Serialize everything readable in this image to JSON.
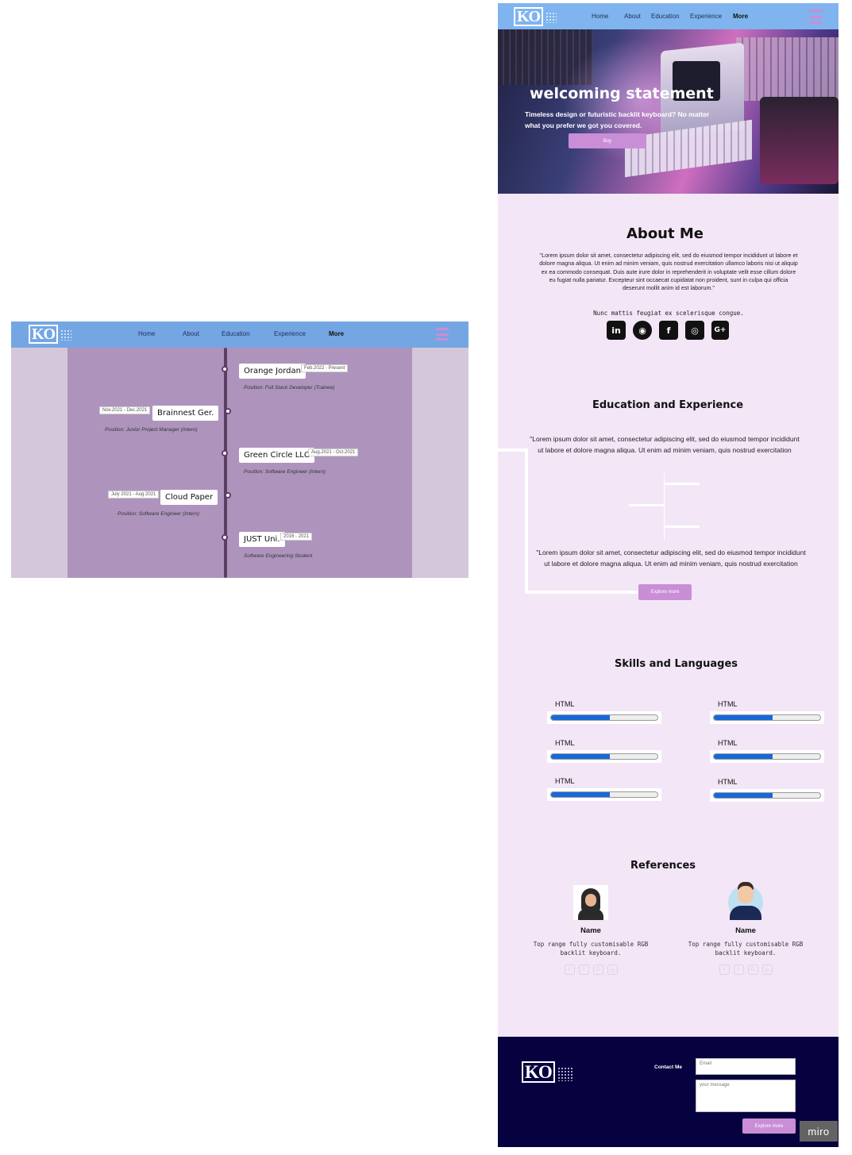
{
  "nav": {
    "logo": "KO",
    "links": [
      "Home",
      "About",
      "Education",
      "Experience",
      "More"
    ]
  },
  "timeline": {
    "entries": [
      {
        "title": "Orange Jordan",
        "date": "Feb.2022 - Present",
        "position": "Position: Full Stack Developer (Trainee)",
        "side": "right"
      },
      {
        "title": "Brainnest Ger.",
        "date": "Nov.2021 - Dec.2021",
        "position": "Position: Junior Project Manager (Intern)",
        "side": "left"
      },
      {
        "title": "Green Circle LLC",
        "date": "Aug.2021 - Oct.2021",
        "position": "Position: Software Engineer (Intern)",
        "side": "right"
      },
      {
        "title": "Cloud Paper",
        "date": "July 2021 - Aug 2021",
        "position": "Position: Software Engineer (Intern)",
        "side": "left"
      },
      {
        "title": "JUST Uni.",
        "date": "2016 - 2021",
        "position": "Software Engineering Student",
        "side": "right"
      }
    ]
  },
  "hero": {
    "heading": "welcoming statement",
    "text": "Timeless design or futuristic backlit keyboard? No matter what you prefer we got you covered.",
    "button": "Buy"
  },
  "about": {
    "title": "About Me",
    "quote": "\"Lorem ipsum dolor sit amet, consectetur adipiscing elit, sed do eiusmod tempor incididunt ut labore et dolore magna aliqua. Ut enim ad minim veniam, quis nostrud exercitation ullamco laboris nisi ut aliquip ex ea commodo consequat. Duis aute irure dolor in reprehenderit in voluptate velit esse cillum dolore eu fugiat nulla pariatur. Excepteur sint occaecat cupidatat non proident, sunt in culpa qui officia deserunt mollit anim id est laborum.\"",
    "tagline": "Nunc mattis feugiat ex scelerisque congue.",
    "social": [
      {
        "icon": "linkedin-icon",
        "glyph": "in"
      },
      {
        "icon": "github-icon",
        "glyph": "◉"
      },
      {
        "icon": "facebook-icon",
        "glyph": "f"
      },
      {
        "icon": "instagram-icon",
        "glyph": "◎"
      },
      {
        "icon": "google-plus-icon",
        "glyph": "G+"
      }
    ]
  },
  "education": {
    "title": "Education and Experience",
    "para1": "\"Lorem ipsum dolor sit amet, consectetur adipiscing elit, sed do eiusmod tempor incididunt ut labore et dolore magna aliqua. Ut enim ad minim veniam, quis nostrud exercitation",
    "para2": "\"Lorem ipsum dolor sit amet, consectetur adipiscing elit, sed do eiusmod tempor incididunt ut labore et dolore magna aliqua. Ut enim ad minim veniam, quis nostrud exercitation",
    "button": "Explore more"
  },
  "skills": {
    "title": "Skills and Languages",
    "items": [
      {
        "label": "HTML",
        "level": 0.55
      },
      {
        "label": "HTML",
        "level": 0.55
      },
      {
        "label": "HTML",
        "level": 0.55
      },
      {
        "label": "HTML",
        "level": 0.55
      },
      {
        "label": "HTML",
        "level": 0.55
      },
      {
        "label": "HTML",
        "level": 0.55
      }
    ]
  },
  "references": {
    "title": "References",
    "people": [
      {
        "name": "Name",
        "desc": "Top range fully customisable RGB backlit keyboard."
      },
      {
        "name": "Name",
        "desc": "Top range fully customisable RGB backlit keyboard."
      }
    ],
    "mini_icons": [
      "twitter-icon",
      "facebook-icon",
      "google-plus-icon",
      "instagram-icon"
    ]
  },
  "footer": {
    "contact_label": "Contact Me",
    "email_placeholder": "Email",
    "message_placeholder": "your message",
    "button": "Explore more"
  },
  "watermark": "miro",
  "colors": {
    "nav": "#7fb4ef",
    "accent": "#c98ed6",
    "page_bg": "#f3e6f7",
    "timeline_panel": "#ae94bd",
    "footer_bg": "#06013f",
    "skill_fill": "#1769d9"
  }
}
